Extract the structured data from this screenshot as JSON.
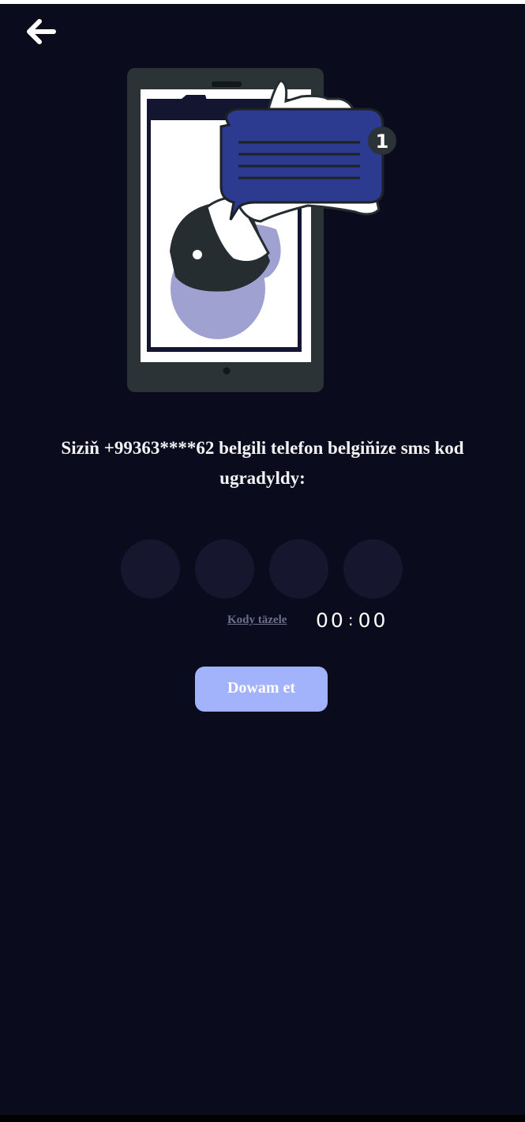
{
  "header": {
    "back_icon": "arrow-left-icon"
  },
  "illustration": {
    "icon": "phone-sms-illustration",
    "badge_count": "1"
  },
  "message": {
    "text": "Siziň +99363****62 belgili telefon belgiňize sms kod ugradyldy:"
  },
  "otp": {
    "digits": [
      "",
      "",
      "",
      ""
    ]
  },
  "resend": {
    "label": "Kody täzele"
  },
  "timer": {
    "minutes": "00",
    "separator": ":",
    "seconds": "00"
  },
  "continue_button": {
    "label": "Dowam et"
  },
  "colors": {
    "background": "#0a0b1c",
    "otp_box": "#16172f",
    "button": "#a3b3fb",
    "bubble": "#2c3a8f",
    "phone": "#2b3337"
  }
}
